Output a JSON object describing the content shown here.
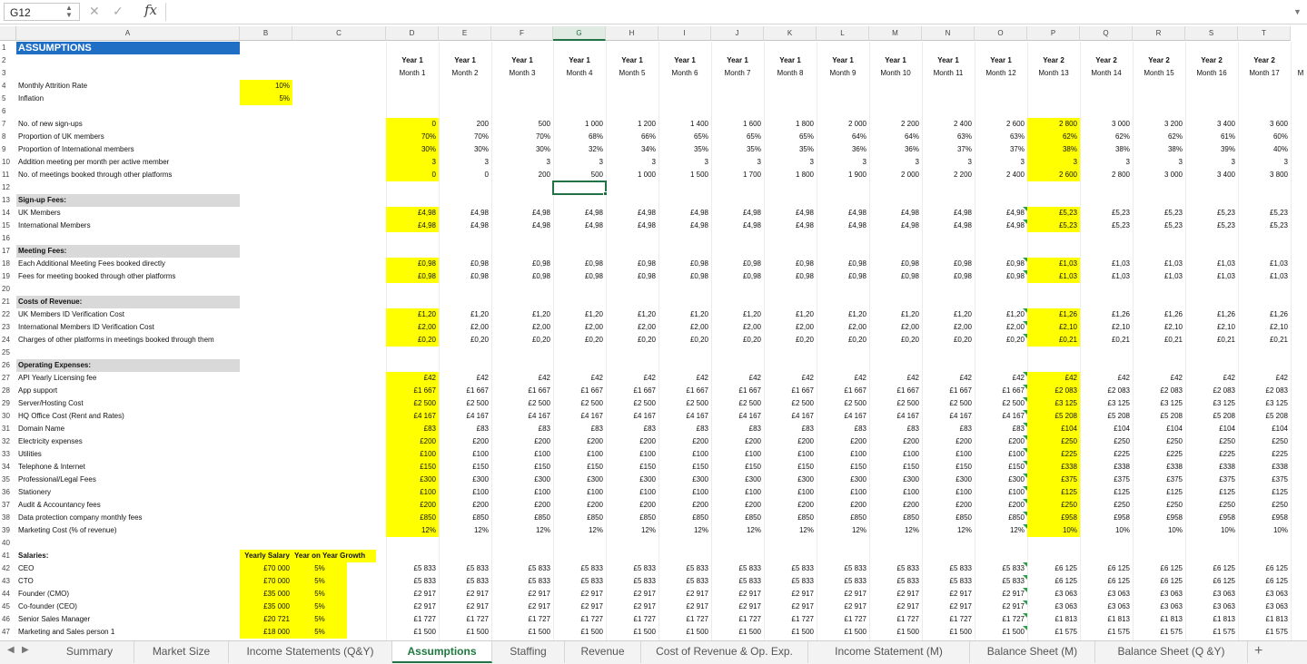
{
  "namebox": "G12",
  "formula": "",
  "columns": [
    "A",
    "B",
    "C",
    "D",
    "E",
    "F",
    "G",
    "H",
    "I",
    "J",
    "K",
    "L",
    "M",
    "N",
    "O",
    "P",
    "Q",
    "R",
    "S",
    "T"
  ],
  "selected_column": "G",
  "year_row": [
    "Year 1",
    "Year 1",
    "Year 1",
    "Year 1",
    "Year 1",
    "Year 1",
    "Year 1",
    "Year 1",
    "Year 1",
    "Year 1",
    "Year 1",
    "Year 1",
    "Year 2",
    "Year 2",
    "Year 2",
    "Year 2",
    "Year 2"
  ],
  "month_row": [
    "Month 1",
    "Month 2",
    "Month 3",
    "Month 4",
    "Month 5",
    "Month 6",
    "Month 7",
    "Month 8",
    "Month 9",
    "Month 10",
    "Month 11",
    "Month 12",
    "Month 13",
    "Month 14",
    "Month 15",
    "Month 16",
    "Month 17"
  ],
  "edge_label": "M",
  "rows": [
    {
      "n": "1",
      "label": "ASSUMPTIONS",
      "style": "title"
    },
    {
      "n": "2"
    },
    {
      "n": "3"
    },
    {
      "n": "4",
      "label": "Monthly Attrition Rate",
      "b": "10%"
    },
    {
      "n": "5",
      "label": "Inflation",
      "b": "5%"
    },
    {
      "n": "6"
    },
    {
      "n": "7",
      "label": "No. of new sign-ups",
      "v": [
        "0",
        "200",
        "500",
        "1 000",
        "1 200",
        "1 400",
        "1 600",
        "1 800",
        "2 000",
        "2 200",
        "2 400",
        "2 600",
        "2 800",
        "3 000",
        "3 200",
        "3 400",
        "3 600"
      ]
    },
    {
      "n": "8",
      "label": "Proportion of UK members",
      "v": [
        "70%",
        "70%",
        "70%",
        "68%",
        "66%",
        "65%",
        "65%",
        "65%",
        "64%",
        "64%",
        "63%",
        "63%",
        "62%",
        "62%",
        "62%",
        "61%",
        "60%"
      ]
    },
    {
      "n": "9",
      "label": "Proportion of International members",
      "v": [
        "30%",
        "30%",
        "30%",
        "32%",
        "34%",
        "35%",
        "35%",
        "35%",
        "36%",
        "36%",
        "37%",
        "37%",
        "38%",
        "38%",
        "38%",
        "39%",
        "40%"
      ]
    },
    {
      "n": "10",
      "label": "Addition meeting per month per active member",
      "v": [
        "3",
        "3",
        "3",
        "3",
        "3",
        "3",
        "3",
        "3",
        "3",
        "3",
        "3",
        "3",
        "3",
        "3",
        "3",
        "3",
        "3"
      ]
    },
    {
      "n": "11",
      "label": "No. of meetings booked through other platforms",
      "v": [
        "0",
        "0",
        "200",
        "500",
        "1 000",
        "1 500",
        "1 700",
        "1 800",
        "1 900",
        "2 000",
        "2 200",
        "2 400",
        "2 600",
        "2 800",
        "3 000",
        "3 400",
        "3 800"
      ]
    },
    {
      "n": "12"
    },
    {
      "n": "13",
      "label": "Sign-up Fees:",
      "style": "sec"
    },
    {
      "n": "14",
      "label": "UK Members",
      "v": [
        "£4,98",
        "£4,98",
        "£4,98",
        "£4,98",
        "£4,98",
        "£4,98",
        "£4,98",
        "£4,98",
        "£4,98",
        "£4,98",
        "£4,98",
        "£4,98",
        "£5,23",
        "£5,23",
        "£5,23",
        "£5,23",
        "£5,23"
      ]
    },
    {
      "n": "15",
      "label": "International Members",
      "v": [
        "£4,98",
        "£4,98",
        "£4,98",
        "£4,98",
        "£4,98",
        "£4,98",
        "£4,98",
        "£4,98",
        "£4,98",
        "£4,98",
        "£4,98",
        "£4,98",
        "£5,23",
        "£5,23",
        "£5,23",
        "£5,23",
        "£5,23"
      ]
    },
    {
      "n": "16"
    },
    {
      "n": "17",
      "label": "Meeting Fees:",
      "style": "sec"
    },
    {
      "n": "18",
      "label": "Each Additional Meeting Fees booked directly",
      "v": [
        "£0,98",
        "£0,98",
        "£0,98",
        "£0,98",
        "£0,98",
        "£0,98",
        "£0,98",
        "£0,98",
        "£0,98",
        "£0,98",
        "£0,98",
        "£0,98",
        "£1,03",
        "£1,03",
        "£1,03",
        "£1,03",
        "£1,03"
      ]
    },
    {
      "n": "19",
      "label": "Fees for meeting booked through other platforms",
      "v": [
        "£0,98",
        "£0,98",
        "£0,98",
        "£0,98",
        "£0,98",
        "£0,98",
        "£0,98",
        "£0,98",
        "£0,98",
        "£0,98",
        "£0,98",
        "£0,98",
        "£1,03",
        "£1,03",
        "£1,03",
        "£1,03",
        "£1,03"
      ]
    },
    {
      "n": "20"
    },
    {
      "n": "21",
      "label": "Costs of Revenue:",
      "style": "sec"
    },
    {
      "n": "22",
      "label": "UK Members ID Verification Cost",
      "v": [
        "£1,20",
        "£1,20",
        "£1,20",
        "£1,20",
        "£1,20",
        "£1,20",
        "£1,20",
        "£1,20",
        "£1,20",
        "£1,20",
        "£1,20",
        "£1,20",
        "£1,26",
        "£1,26",
        "£1,26",
        "£1,26",
        "£1,26"
      ]
    },
    {
      "n": "23",
      "label": "International Members ID Verification Cost",
      "v": [
        "£2,00",
        "£2,00",
        "£2,00",
        "£2,00",
        "£2,00",
        "£2,00",
        "£2,00",
        "£2,00",
        "£2,00",
        "£2,00",
        "£2,00",
        "£2,00",
        "£2,10",
        "£2,10",
        "£2,10",
        "£2,10",
        "£2,10"
      ]
    },
    {
      "n": "24",
      "label": "Charges of other platforms in meetings booked through them",
      "v": [
        "£0,20",
        "£0,20",
        "£0,20",
        "£0,20",
        "£0,20",
        "£0,20",
        "£0,20",
        "£0,20",
        "£0,20",
        "£0,20",
        "£0,20",
        "£0,20",
        "£0,21",
        "£0,21",
        "£0,21",
        "£0,21",
        "£0,21"
      ]
    },
    {
      "n": "25"
    },
    {
      "n": "26",
      "label": "Operating Expenses:",
      "style": "sec"
    },
    {
      "n": "27",
      "label": "API Yearly Licensing fee",
      "v": [
        "£42",
        "£42",
        "£42",
        "£42",
        "£42",
        "£42",
        "£42",
        "£42",
        "£42",
        "£42",
        "£42",
        "£42",
        "£42",
        "£42",
        "£42",
        "£42",
        "£42"
      ]
    },
    {
      "n": "28",
      "label": "App support",
      "v": [
        "£1 667",
        "£1 667",
        "£1 667",
        "£1 667",
        "£1 667",
        "£1 667",
        "£1 667",
        "£1 667",
        "£1 667",
        "£1 667",
        "£1 667",
        "£1 667",
        "£2 083",
        "£2 083",
        "£2 083",
        "£2 083",
        "£2 083"
      ]
    },
    {
      "n": "29",
      "label": "Server/Hosting Cost",
      "v": [
        "£2 500",
        "£2 500",
        "£2 500",
        "£2 500",
        "£2 500",
        "£2 500",
        "£2 500",
        "£2 500",
        "£2 500",
        "£2 500",
        "£2 500",
        "£2 500",
        "£3 125",
        "£3 125",
        "£3 125",
        "£3 125",
        "£3 125"
      ]
    },
    {
      "n": "30",
      "label": "HQ Office Cost (Rent and Rates)",
      "v": [
        "£4 167",
        "£4 167",
        "£4 167",
        "£4 167",
        "£4 167",
        "£4 167",
        "£4 167",
        "£4 167",
        "£4 167",
        "£4 167",
        "£4 167",
        "£4 167",
        "£5 208",
        "£5 208",
        "£5 208",
        "£5 208",
        "£5 208"
      ]
    },
    {
      "n": "31",
      "label": "Domain Name",
      "v": [
        "£83",
        "£83",
        "£83",
        "£83",
        "£83",
        "£83",
        "£83",
        "£83",
        "£83",
        "£83",
        "£83",
        "£83",
        "£104",
        "£104",
        "£104",
        "£104",
        "£104"
      ]
    },
    {
      "n": "32",
      "label": "Electricity expenses",
      "v": [
        "£200",
        "£200",
        "£200",
        "£200",
        "£200",
        "£200",
        "£200",
        "£200",
        "£200",
        "£200",
        "£200",
        "£200",
        "£250",
        "£250",
        "£250",
        "£250",
        "£250"
      ]
    },
    {
      "n": "33",
      "label": "Utilities",
      "v": [
        "£100",
        "£100",
        "£100",
        "£100",
        "£100",
        "£100",
        "£100",
        "£100",
        "£100",
        "£100",
        "£100",
        "£100",
        "£225",
        "£225",
        "£225",
        "£225",
        "£225"
      ]
    },
    {
      "n": "34",
      "label": "Telephone & Internet",
      "v": [
        "£150",
        "£150",
        "£150",
        "£150",
        "£150",
        "£150",
        "£150",
        "£150",
        "£150",
        "£150",
        "£150",
        "£150",
        "£338",
        "£338",
        "£338",
        "£338",
        "£338"
      ]
    },
    {
      "n": "35",
      "label": "Professional/Legal Fees",
      "v": [
        "£300",
        "£300",
        "£300",
        "£300",
        "£300",
        "£300",
        "£300",
        "£300",
        "£300",
        "£300",
        "£300",
        "£300",
        "£375",
        "£375",
        "£375",
        "£375",
        "£375"
      ]
    },
    {
      "n": "36",
      "label": "Stationery",
      "v": [
        "£100",
        "£100",
        "£100",
        "£100",
        "£100",
        "£100",
        "£100",
        "£100",
        "£100",
        "£100",
        "£100",
        "£100",
        "£125",
        "£125",
        "£125",
        "£125",
        "£125"
      ]
    },
    {
      "n": "37",
      "label": "Audit & Accountancy fees",
      "v": [
        "£200",
        "£200",
        "£200",
        "£200",
        "£200",
        "£200",
        "£200",
        "£200",
        "£200",
        "£200",
        "£200",
        "£200",
        "£250",
        "£250",
        "£250",
        "£250",
        "£250"
      ]
    },
    {
      "n": "38",
      "label": "Data protection company monthly fees",
      "v": [
        "£850",
        "£850",
        "£850",
        "£850",
        "£850",
        "£850",
        "£850",
        "£850",
        "£850",
        "£850",
        "£850",
        "£850",
        "£958",
        "£958",
        "£958",
        "£958",
        "£958"
      ]
    },
    {
      "n": "39",
      "label": "Marketing Cost (% of revenue)",
      "v": [
        "12%",
        "12%",
        "12%",
        "12%",
        "12%",
        "12%",
        "12%",
        "12%",
        "12%",
        "12%",
        "12%",
        "12%",
        "10%",
        "10%",
        "10%",
        "10%",
        "10%"
      ]
    },
    {
      "n": "40"
    },
    {
      "n": "41",
      "label": "Salaries:",
      "style": "bold",
      "b": "Yearly Salary",
      "c": "Year on Year Growth"
    },
    {
      "n": "42",
      "label": "CEO",
      "b": "£70 000",
      "c": "5%",
      "v": [
        "£5 833",
        "£5 833",
        "£5 833",
        "£5 833",
        "£5 833",
        "£5 833",
        "£5 833",
        "£5 833",
        "£5 833",
        "£5 833",
        "£5 833",
        "£5 833",
        "£6 125",
        "£6 125",
        "£6 125",
        "£6 125",
        "£6 125"
      ]
    },
    {
      "n": "43",
      "label": "CTO",
      "b": "£70 000",
      "c": "5%",
      "v": [
        "£5 833",
        "£5 833",
        "£5 833",
        "£5 833",
        "£5 833",
        "£5 833",
        "£5 833",
        "£5 833",
        "£5 833",
        "£5 833",
        "£5 833",
        "£5 833",
        "£6 125",
        "£6 125",
        "£6 125",
        "£6 125",
        "£6 125"
      ]
    },
    {
      "n": "44",
      "label": "Founder (CMO)",
      "b": "£35 000",
      "c": "5%",
      "v": [
        "£2 917",
        "£2 917",
        "£2 917",
        "£2 917",
        "£2 917",
        "£2 917",
        "£2 917",
        "£2 917",
        "£2 917",
        "£2 917",
        "£2 917",
        "£2 917",
        "£3 063",
        "£3 063",
        "£3 063",
        "£3 063",
        "£3 063"
      ]
    },
    {
      "n": "45",
      "label": "Co-founder (CEO)",
      "b": "£35 000",
      "c": "5%",
      "v": [
        "£2 917",
        "£2 917",
        "£2 917",
        "£2 917",
        "£2 917",
        "£2 917",
        "£2 917",
        "£2 917",
        "£2 917",
        "£2 917",
        "£2 917",
        "£2 917",
        "£3 063",
        "£3 063",
        "£3 063",
        "£3 063",
        "£3 063"
      ]
    },
    {
      "n": "46",
      "label": "Senior Sales Manager",
      "b": "£20 721",
      "c": "5%",
      "v": [
        "£1 727",
        "£1 727",
        "£1 727",
        "£1 727",
        "£1 727",
        "£1 727",
        "£1 727",
        "£1 727",
        "£1 727",
        "£1 727",
        "£1 727",
        "£1 727",
        "£1 813",
        "£1 813",
        "£1 813",
        "£1 813",
        "£1 813"
      ]
    },
    {
      "n": "47",
      "label": "Marketing and Sales person 1",
      "b": "£18 000",
      "c": "5%",
      "v": [
        "£1 500",
        "£1 500",
        "£1 500",
        "£1 500",
        "£1 500",
        "£1 500",
        "£1 500",
        "£1 500",
        "£1 500",
        "£1 500",
        "£1 500",
        "£1 500",
        "£1 575",
        "£1 575",
        "£1 575",
        "£1 575",
        "£1 575"
      ]
    }
  ],
  "tabs": [
    "Summary",
    "Market Size",
    "Income Statements (Q&Y)",
    "Assumptions",
    "Staffing",
    "Revenue",
    "Cost of Revenue & Op. Exp.",
    "Income Statement (M)",
    "Balance Sheet (M)",
    "Balance Sheet (Q &Y)"
  ],
  "active_tab": "Assumptions",
  "colors": {
    "highlight": "#ffff00",
    "title": "#1f6fc5",
    "section": "#d9d9d9",
    "excel_green": "#217346"
  }
}
